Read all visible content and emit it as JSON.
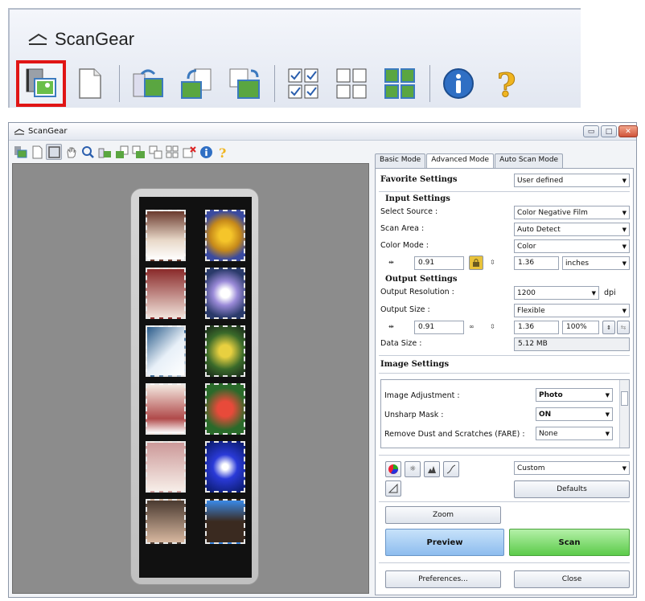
{
  "zoom": {
    "title": "ScanGear",
    "buttons": [
      {
        "name": "thumbnail-view-icon",
        "selected": true
      },
      {
        "name": "whole-image-view-icon"
      },
      {
        "name": "rotate-left-icon"
      },
      {
        "name": "rotate-right-icon"
      },
      {
        "name": "auto-crop-icon"
      },
      {
        "name": "check-all-frames-icon"
      },
      {
        "name": "uncheck-all-frames-icon"
      },
      {
        "name": "select-all-frames-icon"
      },
      {
        "name": "information-icon"
      },
      {
        "name": "help-icon"
      }
    ]
  },
  "window": {
    "title": "ScanGear",
    "controls": {
      "minimize": "▭",
      "maximize": "□",
      "close": "✕"
    }
  },
  "tabs": [
    "Basic Mode",
    "Advanced Mode",
    "Auto Scan Mode"
  ],
  "favorite": {
    "label": "Favorite Settings",
    "value": "User defined"
  },
  "input_settings": {
    "heading": "Input Settings",
    "select_source_label": "Select Source :",
    "select_source_value": "Color Negative Film",
    "scan_area_label": "Scan Area :",
    "scan_area_value": "Auto Detect",
    "color_mode_label": "Color Mode :",
    "color_mode_value": "Color",
    "width": "0.91",
    "height": "1.36",
    "unit": "inches"
  },
  "output_settings": {
    "heading": "Output Settings",
    "resolution_label": "Output Resolution :",
    "resolution_value": "1200",
    "dpi": "dpi",
    "size_label": "Output Size :",
    "size_value": "Flexible",
    "width": "0.91",
    "height": "1.36",
    "scale": "100%",
    "data_size_label": "Data Size :",
    "data_size_value": "5.12 MB"
  },
  "image_settings": {
    "heading": "Image Settings",
    "adjustment_label": "Image Adjustment :",
    "adjustment_value": "Photo",
    "unsharp_label": "Unsharp Mask :",
    "unsharp_value": "ON",
    "dust_label": "Remove Dust and Scratches (FARE) :",
    "dust_value": "None"
  },
  "color_adjust": {
    "preset": "Custom",
    "defaults": "Defaults"
  },
  "buttons": {
    "zoom": "Zoom",
    "preview": "Preview",
    "scan": "Scan",
    "preferences": "Preferences...",
    "close": "Close"
  },
  "colors": {
    "selected_outline": "#e01515",
    "preview_button": "#9cc8f2",
    "scan_button": "#7fdc73"
  }
}
